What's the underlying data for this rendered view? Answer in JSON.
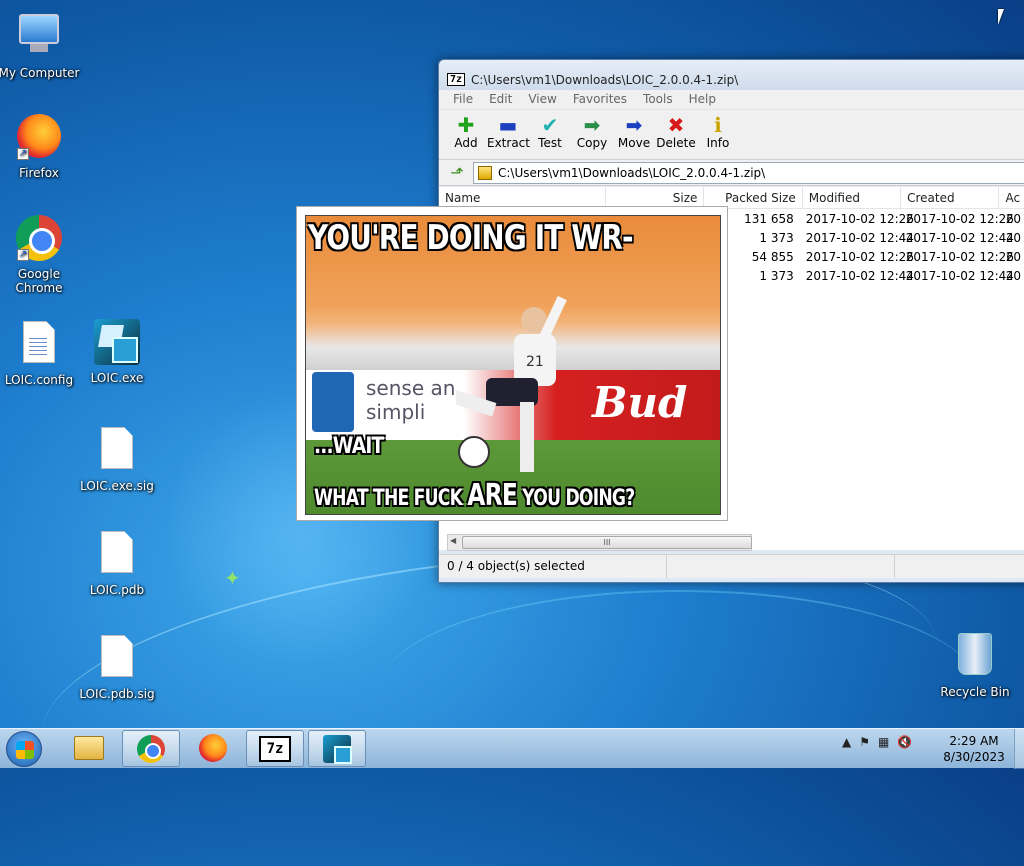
{
  "desktop": {
    "icons": [
      {
        "label": "My Computer"
      },
      {
        "label": "Firefox"
      },
      {
        "label": "Google Chrome"
      },
      {
        "label": "LOIC.config"
      },
      {
        "label": "LOIC.exe"
      },
      {
        "label": "LOIC.exe.sig"
      },
      {
        "label": "LOIC.pdb"
      },
      {
        "label": "LOIC.pdb.sig"
      },
      {
        "label": "Recycle Bin"
      }
    ]
  },
  "window": {
    "title": "C:\\Users\\vm1\\Downloads\\LOIC_2.0.0.4-1.zip\\",
    "app_badge": "7z",
    "menu": [
      "File",
      "Edit",
      "View",
      "Favorites",
      "Tools",
      "Help"
    ],
    "toolbar": [
      {
        "label": "Add",
        "icon": "plus-icon",
        "color": "#1fa31f"
      },
      {
        "label": "Extract",
        "icon": "minus-icon",
        "color": "#1b3fbf"
      },
      {
        "label": "Test",
        "icon": "check-icon",
        "color": "#1fb0b0"
      },
      {
        "label": "Copy",
        "icon": "copy-arrow-icon",
        "color": "#2b8f4a"
      },
      {
        "label": "Move",
        "icon": "move-arrow-icon",
        "color": "#1b3fbf"
      },
      {
        "label": "Delete",
        "icon": "delete-x-icon",
        "color": "#d61a1a"
      },
      {
        "label": "Info",
        "icon": "info-icon",
        "color": "#c9a400"
      }
    ],
    "address": "C:\\Users\\vm1\\Downloads\\LOIC_2.0.0.4-1.zip\\",
    "columns": {
      "name": "Name",
      "size": "Size",
      "packed": "Packed Size",
      "modified": "Modified",
      "created": "Created",
      "accessed": "Ac"
    },
    "rows": [
      {
        "packed": "131 658",
        "modified": "2017-10-02 12:26",
        "created": "2017-10-02 12:26",
        "accessed": "20"
      },
      {
        "packed": "1 373",
        "modified": "2017-10-02 12:44",
        "created": "2017-10-02 12:44",
        "accessed": "20"
      },
      {
        "packed": "54 855",
        "modified": "2017-10-02 12:26",
        "created": "2017-10-02 12:26",
        "accessed": "20"
      },
      {
        "packed": "1 373",
        "modified": "2017-10-02 12:44",
        "created": "2017-10-02 12:44",
        "accessed": "20"
      }
    ],
    "status": "0 / 4 object(s) selected",
    "scroll_thumb": "III"
  },
  "meme": {
    "top": "YOU'RE DOING IT WR-",
    "middle": "...WAIT",
    "bottom_a": "WHAT THE FUCK ",
    "bottom_b": "ARE",
    "bottom_c": " YOU DOING?",
    "bg_sign_left": "sense an",
    "bg_sign_left2": "simpli",
    "bg_sign_right": "Bud",
    "jersey": "21"
  },
  "taskbar": {
    "items": [
      {
        "name": "explorer",
        "active": false
      },
      {
        "name": "chrome",
        "active": true
      },
      {
        "name": "firefox",
        "active": false
      },
      {
        "name": "7zip",
        "active": false
      },
      {
        "name": "loic",
        "active": true
      }
    ],
    "tray_up": "▲",
    "time": "2:29 AM",
    "date": "8/30/2023"
  }
}
